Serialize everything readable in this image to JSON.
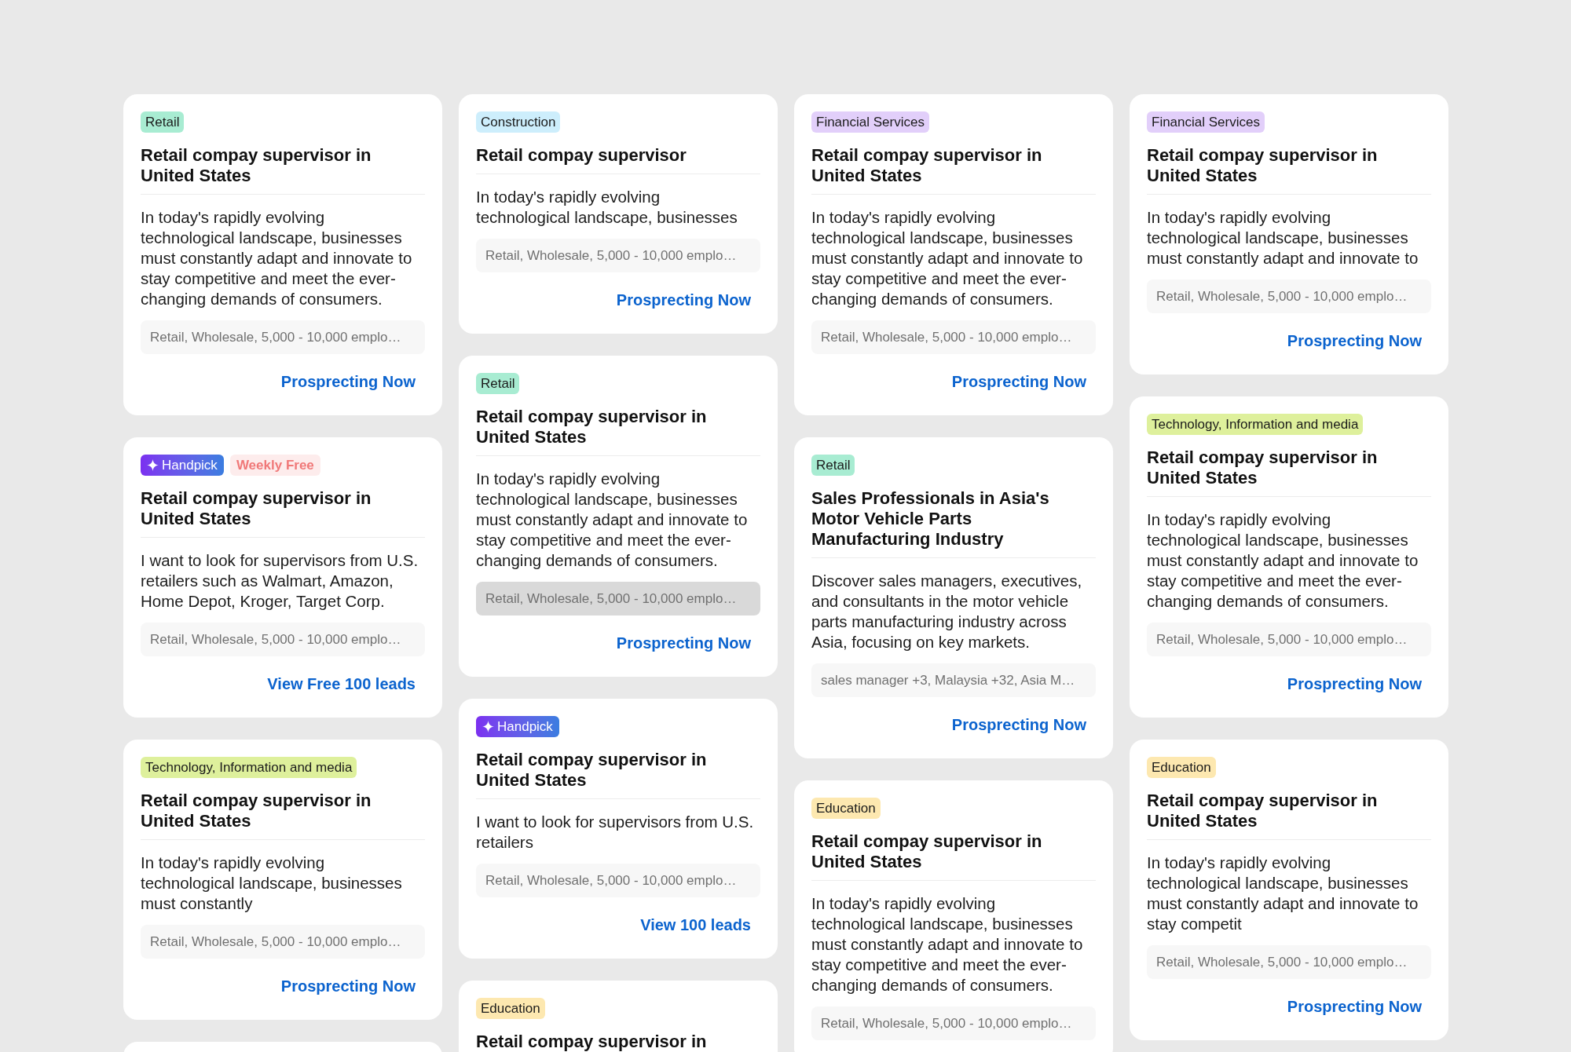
{
  "columns": [
    {
      "cards": [
        {
          "tags": [
            {
              "kind": "category",
              "label": "Retail",
              "color": "#a8ecd2"
            }
          ],
          "title": "Retail compay supervisor in United States",
          "description": "In today's rapidly evolving technological landscape, businesses must constantly adapt and innovate to stay competitive and meet the ever-changing demands of consumers.",
          "meta": "Retail, Wholesale, 5,000 - 10,000 emplo…",
          "meta_highlighted": false,
          "action": "Prosprecting Now"
        },
        {
          "tags": [
            {
              "kind": "handpick",
              "label": "Handpick"
            },
            {
              "kind": "weekly_free",
              "label": "Weekly Free"
            }
          ],
          "title": "Retail compay supervisor in United States",
          "description": "I want to look for supervisors from U.S. retailers such as Walmart, Amazon, Home Depot, Kroger, Target Corp.",
          "meta": "Retail, Wholesale, 5,000 - 10,000 emplo…",
          "meta_highlighted": false,
          "action": "View Free 100 leads"
        },
        {
          "tags": [
            {
              "kind": "category",
              "label": "Technology, Information and media",
              "color": "#def09c"
            }
          ],
          "title": "Retail compay supervisor in United States",
          "description": "In today's rapidly evolving technological landscape, businesses must constantly",
          "meta": "Retail, Wholesale, 5,000 - 10,000 emplo…",
          "meta_highlighted": false,
          "action": "Prosprecting Now"
        },
        {
          "kind": "cut_off"
        }
      ]
    },
    {
      "cards": [
        {
          "tags": [
            {
              "kind": "category",
              "label": "Construction",
              "color": "#cdeefc"
            }
          ],
          "title": "Retail compay supervisor",
          "description": "In today's rapidly evolving technological landscape, businesses",
          "meta": "Retail, Wholesale, 5,000 - 10,000 emplo…",
          "meta_highlighted": false,
          "action": "Prosprecting Now"
        },
        {
          "tags": [
            {
              "kind": "category",
              "label": "Retail",
              "color": "#a8ecd2"
            }
          ],
          "title": "Retail compay supervisor in United States",
          "description": "In today's rapidly evolving technological landscape, businesses must constantly adapt and innovate to stay competitive and meet the ever-changing demands of consumers.",
          "meta": "Retail, Wholesale, 5,000 - 10,000 emplo…",
          "meta_highlighted": true,
          "action": "Prosprecting Now"
        },
        {
          "tags": [
            {
              "kind": "handpick",
              "label": "Handpick"
            }
          ],
          "title": "Retail compay supervisor in United States",
          "description": "I want to look for supervisors from U.S. retailers",
          "meta": "Retail, Wholesale, 5,000 - 10,000 emplo…",
          "meta_highlighted": false,
          "action": "View 100 leads"
        },
        {
          "tags": [
            {
              "kind": "category",
              "label": "Education",
              "color": "#fde8b0"
            }
          ],
          "title": "Retail compay supervisor in"
        }
      ]
    },
    {
      "cards": [
        {
          "tags": [
            {
              "kind": "category",
              "label": "Financial Services",
              "color": "#e2cffa"
            }
          ],
          "title": "Retail compay supervisor in United States",
          "description": "In today's rapidly evolving technological landscape, businesses must constantly adapt and innovate to stay competitive and meet the ever-changing demands of consumers.",
          "meta": "Retail, Wholesale, 5,000 - 10,000 emplo…",
          "meta_highlighted": false,
          "action": "Prosprecting Now"
        },
        {
          "tags": [
            {
              "kind": "category",
              "label": "Retail",
              "color": "#a8ecd2"
            }
          ],
          "title": "Sales Professionals in Asia's Motor Vehicle Parts Manufacturing Industry",
          "description": "Discover sales managers, executives, and consultants in the motor vehicle parts manufacturing industry across Asia, focusing on key markets.",
          "meta": "sales manager +3, Malaysia +32, Asia M…",
          "meta_highlighted": false,
          "action": "Prosprecting Now"
        },
        {
          "tags": [
            {
              "kind": "category",
              "label": "Education",
              "color": "#fde8b0"
            }
          ],
          "title": "Retail compay supervisor in United States",
          "description": "In today's rapidly evolving technological landscape, businesses must constantly adapt and innovate to stay competitive and meet the ever-changing demands of consumers.",
          "meta": "Retail, Wholesale, 5,000 - 10,000 emplo…",
          "meta_highlighted": false
        }
      ]
    },
    {
      "cards": [
        {
          "tags": [
            {
              "kind": "category",
              "label": "Financial Services",
              "color": "#e2cffa"
            }
          ],
          "title": "Retail compay supervisor in United States",
          "description": "In today's rapidly evolving technological landscape, businesses must constantly adapt and innovate to",
          "meta": "Retail, Wholesale, 5,000 - 10,000 emplo…",
          "meta_highlighted": false,
          "action": "Prosprecting Now"
        },
        {
          "tags": [
            {
              "kind": "category",
              "label": "Technology, Information and media",
              "color": "#def09c"
            }
          ],
          "title": "Retail compay supervisor in United States",
          "description": "In today's rapidly evolving technological landscape, businesses must constantly adapt and innovate to stay competitive and meet the ever-changing demands of consumers.",
          "meta": "Retail, Wholesale, 5,000 - 10,000 emplo…",
          "meta_highlighted": false,
          "action": "Prosprecting Now"
        },
        {
          "tags": [
            {
              "kind": "category",
              "label": "Education",
              "color": "#fde8b0"
            }
          ],
          "title": "Retail compay supervisor in United States",
          "description": "In today's rapidly evolving technological landscape, businesses must constantly adapt and innovate to stay competit",
          "meta": "Retail, Wholesale, 5,000 - 10,000 emplo…",
          "meta_highlighted": false,
          "action": "Prosprecting Now"
        }
      ]
    }
  ]
}
